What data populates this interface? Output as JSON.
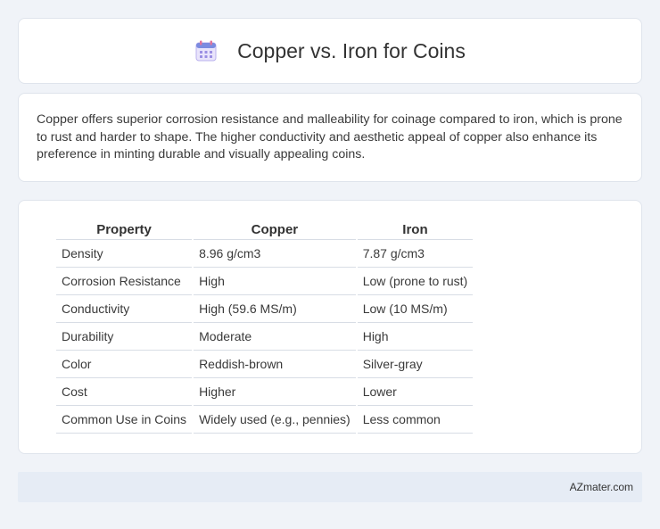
{
  "header": {
    "icon": "calendar-icon",
    "title": "Copper vs. Iron for Coins"
  },
  "description": "Copper offers superior corrosion resistance and malleability for coinage compared to iron, which is prone to rust and harder to shape. The higher conductivity and aesthetic appeal of copper also enhance its preference in minting durable and visually appealing coins.",
  "table": {
    "headers": [
      "Property",
      "Copper",
      "Iron"
    ],
    "rows": [
      [
        "Density",
        "8.96 g/cm3",
        "7.87 g/cm3"
      ],
      [
        "Corrosion Resistance",
        "High",
        "Low (prone to rust)"
      ],
      [
        "Conductivity",
        "High (59.6 MS/m)",
        "Low (10 MS/m)"
      ],
      [
        "Durability",
        "Moderate",
        "High"
      ],
      [
        "Color",
        "Reddish-brown",
        "Silver-gray"
      ],
      [
        "Cost",
        "Higher",
        "Lower"
      ],
      [
        "Common Use in Coins",
        "Widely used (e.g., pennies)",
        "Less common"
      ]
    ]
  },
  "footer": {
    "text": "AZmater.com"
  },
  "colors": {
    "background": "#f0f3f8",
    "card": "#ffffff",
    "footer": "#e6ecf5",
    "icon_accent": "#8a7bd8"
  }
}
